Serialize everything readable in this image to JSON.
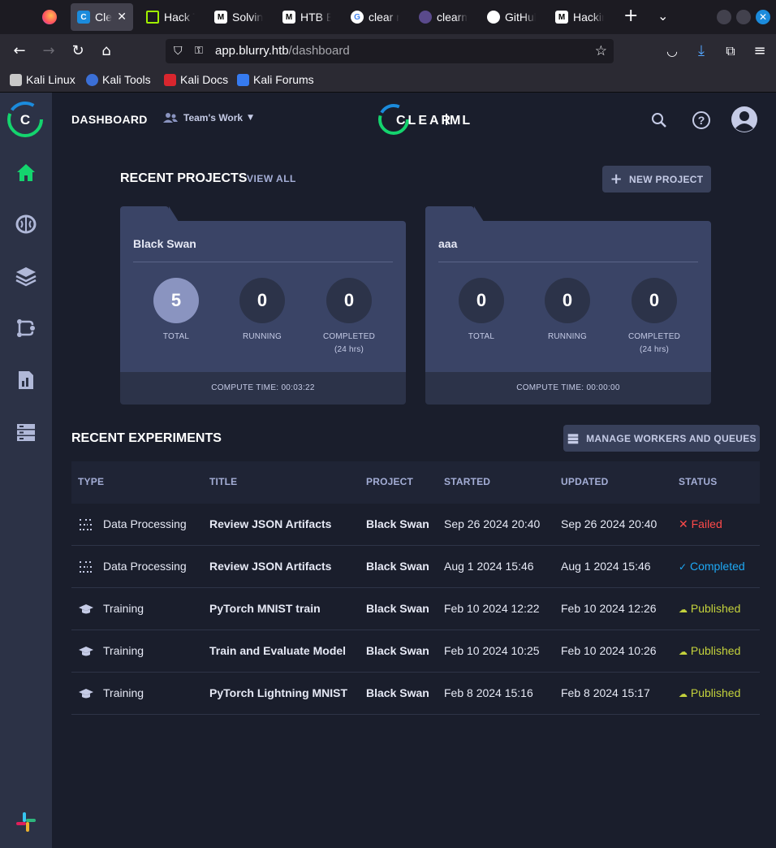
{
  "browser": {
    "tabs": [
      {
        "title": "Clea",
        "icon": "clearml-icon",
        "active": true
      },
      {
        "title": "Hack T",
        "icon": "htb-icon"
      },
      {
        "title": "Solvin",
        "icon": "medium-icon"
      },
      {
        "title": "HTB B",
        "icon": "medium-icon"
      },
      {
        "title": "clear n",
        "icon": "google-icon"
      },
      {
        "title": "clearm",
        "icon": "cat-icon"
      },
      {
        "title": "GitHul",
        "icon": "github-icon"
      },
      {
        "title": "Hackir",
        "icon": "medium-icon"
      }
    ],
    "url_host": "app.blurry.htb",
    "url_path": "/dashboard",
    "bookmarks": [
      "Kali Linux",
      "Kali Tools",
      "Kali Docs",
      "Kali Forums"
    ]
  },
  "header": {
    "title": "DASHBOARD",
    "workspace": "Team's Work",
    "logo_text": "CLEAR|ML"
  },
  "recent_projects": {
    "title": "RECENT PROJECTS",
    "view_all": "VIEW ALL",
    "new_project": "NEW PROJECT",
    "projects": [
      {
        "name": "Black Swan",
        "total": "5",
        "running": "0",
        "completed": "0",
        "compute": "COMPUTE TIME: 00:03:22"
      },
      {
        "name": "aaa",
        "total": "0",
        "running": "0",
        "completed": "0",
        "compute": "COMPUTE TIME: 00:00:00"
      }
    ],
    "labels": {
      "total": "TOTAL",
      "running": "RUNNING",
      "completed": "COMPLETED",
      "completed_sub": "(24 hrs)"
    }
  },
  "recent_experiments": {
    "title": "RECENT EXPERIMENTS",
    "manage_button": "MANAGE WORKERS AND QUEUES",
    "columns": [
      "TYPE",
      "TITLE",
      "PROJECT",
      "STARTED",
      "UPDATED",
      "STATUS"
    ],
    "rows": [
      {
        "type": "Data Processing",
        "title": "Review JSON Artifacts",
        "project": "Black Swan",
        "started": "Sep 26 2024 20:40",
        "updated": "Sep 26 2024 20:40",
        "status": "Failed"
      },
      {
        "type": "Data Processing",
        "title": "Review JSON Artifacts",
        "project": "Black Swan",
        "started": "Aug 1 2024 15:46",
        "updated": "Aug 1 2024 15:46",
        "status": "Completed"
      },
      {
        "type": "Training",
        "title": "PyTorch MNIST train",
        "project": "Black Swan",
        "started": "Feb 10 2024 12:22",
        "updated": "Feb 10 2024 12:26",
        "status": "Published"
      },
      {
        "type": "Training",
        "title": "Train and Evaluate Model",
        "project": "Black Swan",
        "started": "Feb 10 2024 10:25",
        "updated": "Feb 10 2024 10:26",
        "status": "Published"
      },
      {
        "type": "Training",
        "title": "PyTorch Lightning MNIST",
        "project": "Black Swan",
        "started": "Feb 8 2024 15:16",
        "updated": "Feb 8 2024 15:17",
        "status": "Published"
      }
    ]
  },
  "colors": {
    "accent_green": "#14d46e",
    "failed": "#ff4a4a",
    "completed": "#1ea9f5",
    "published": "#c4d23c"
  }
}
